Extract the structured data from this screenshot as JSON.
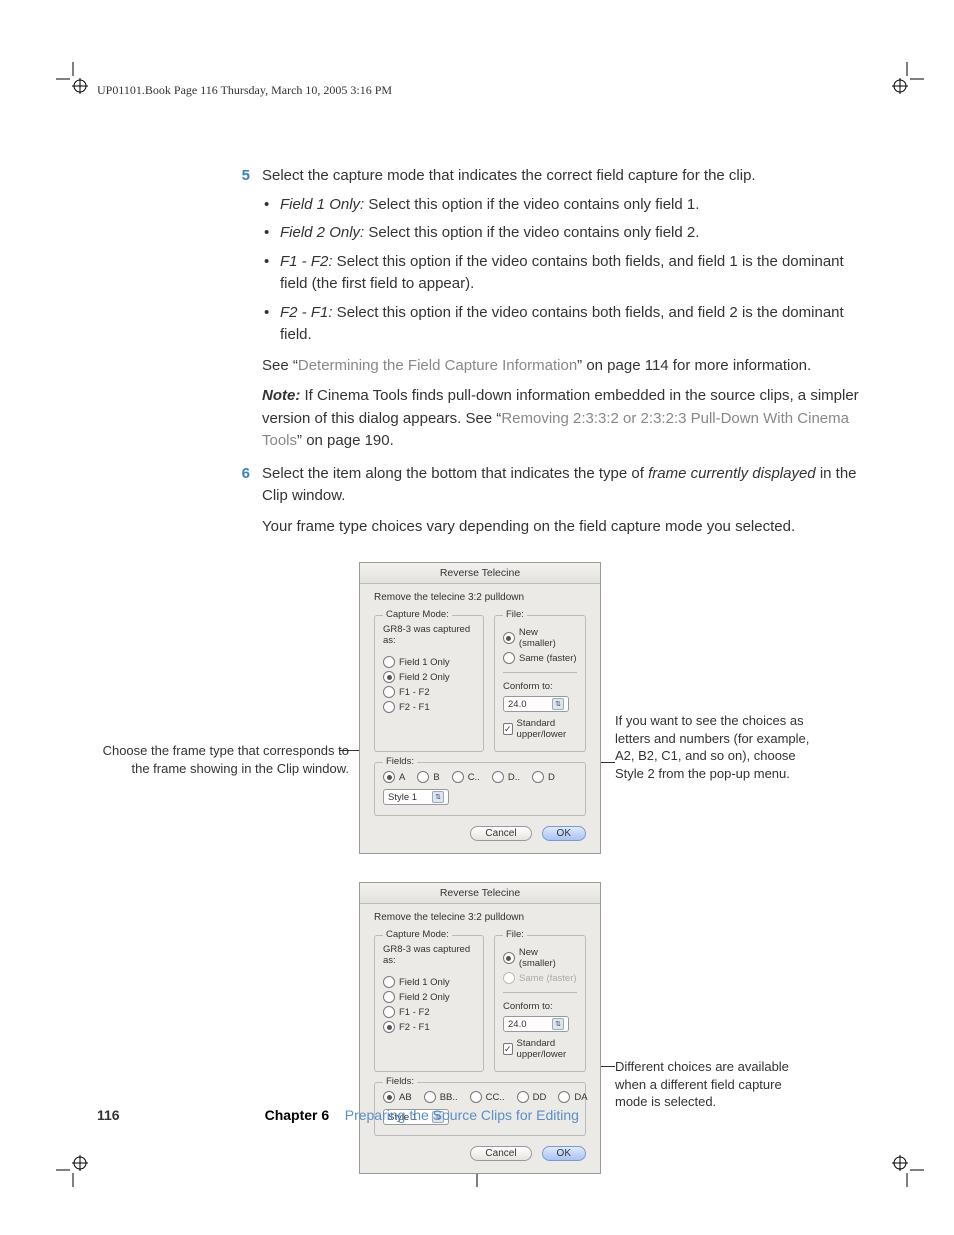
{
  "running_head": "UP01101.Book  Page 116  Thursday, March 10, 2005  3:16 PM",
  "steps": {
    "s5": {
      "num": "5",
      "lead": "Select the capture mode that indicates the correct field capture for the clip.",
      "bullets": [
        {
          "term": "Field 1 Only:",
          "text": "  Select this option if the video contains only field 1."
        },
        {
          "term": "Field 2 Only:",
          "text": "  Select this option if the video contains only field 2."
        },
        {
          "term": "F1 - F2:",
          "text": "  Select this option if the video contains both fields, and field 1 is the dominant field (the first field to appear)."
        },
        {
          "term": "F2 - F1:",
          "text": "  Select this option if the video contains both fields, and field 2 is the dominant field."
        }
      ],
      "see_pre": "See “",
      "see_link": "Determining the Field Capture Information",
      "see_post": "” on page 114 for more information.",
      "note_label": "Note:",
      "note_pre": "  If Cinema Tools finds pull-down information embedded in the source clips, a simpler version of this dialog appears. See “",
      "note_link": "Removing 2:3:3:2 or 2:3:2:3 Pull-Down With Cinema Tools",
      "note_post": "” on page 190."
    },
    "s6": {
      "num": "6",
      "lead_pre": "Select the item along the bottom that indicates the type of ",
      "lead_em": "frame currently displayed",
      "lead_post": " in the Clip window.",
      "para2": "Your frame type choices vary depending on the field capture mode you selected."
    }
  },
  "dialog": {
    "title": "Reverse Telecine",
    "subtitle": "Remove the telecine 3:2 pulldown",
    "capture_legend": "Capture Mode:",
    "capture_caption": "GR8-3 was captured as:",
    "capture_options": [
      "Field 1 Only",
      "Field 2 Only",
      "F1 - F2",
      "F2 - F1"
    ],
    "file_legend": "File:",
    "file_opt_new": "New (smaller)",
    "file_opt_same": "Same (faster)",
    "conform_label": "Conform to:",
    "conform_value": "24.0",
    "std_upper_lower": "Standard upper/lower",
    "fields_legend": "Fields:",
    "field_radios_1": [
      "A",
      "B",
      "C..",
      "D..",
      "D"
    ],
    "field_radios_2": [
      "AB",
      "BB..",
      "CC..",
      "DD",
      "DA"
    ],
    "style_value": "Style 1",
    "cancel": "Cancel",
    "ok": "OK"
  },
  "callouts": {
    "left1": "Choose the frame type that corresponds to the frame showing in the Clip window.",
    "right1": "If you want to see the choices as letters and numbers (for example, A2, B2, C1, and so on), choose Style 2 from the pop-up menu.",
    "right2": "Different choices are available when a different field capture mode is selected."
  },
  "footer": {
    "page": "116",
    "chapter_label": "Chapter 6",
    "chapter_title": "Preparing the Source Clips for Editing"
  }
}
